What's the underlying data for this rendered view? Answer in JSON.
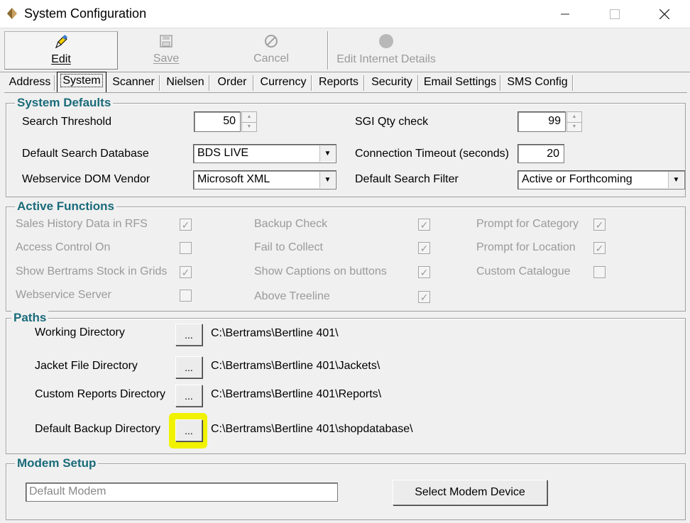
{
  "window": {
    "title": "System Configuration",
    "icon": "app-icon",
    "controls": {
      "minimize": "—",
      "maximize": "☐",
      "close": "✕"
    }
  },
  "toolbar": {
    "edit_label": "Edit",
    "save_label": "Save",
    "cancel_label": "Cancel",
    "edit_internet_label": "Edit Internet Details"
  },
  "tabs": [
    "Address",
    "System",
    "Scanner",
    "Nielsen",
    "Order",
    "Currency",
    "Reports",
    "Security",
    "Email Settings",
    "SMS Config"
  ],
  "active_tab": "System",
  "system_defaults": {
    "title": "System Defaults",
    "search_threshold": {
      "label": "Search Threshold",
      "value": "50"
    },
    "sgi_qty_check": {
      "label": "SGI Qty check",
      "value": "99"
    },
    "default_search_database": {
      "label": "Default Search Database",
      "value": "BDS LIVE"
    },
    "connection_timeout": {
      "label": "Connection Timeout (seconds)",
      "value": "20"
    },
    "webservice_dom_vendor": {
      "label": "Webservice DOM Vendor",
      "value": "Microsoft XML"
    },
    "default_search_filter": {
      "label": "Default Search Filter",
      "value": "Active or Forthcoming"
    }
  },
  "active_functions": {
    "title": "Active Functions",
    "items": [
      {
        "label": "Sales History Data in RFS",
        "checked": true
      },
      {
        "label": "Access Control On",
        "checked": false
      },
      {
        "label": "Show Bertrams Stock in Grids",
        "checked": true
      },
      {
        "label": "Webservice Server",
        "checked": false
      },
      {
        "label": "Backup Check",
        "checked": true
      },
      {
        "label": "Fail to Collect",
        "checked": true
      },
      {
        "label": "Show Captions on buttons",
        "checked": true
      },
      {
        "label": "Above Treeline",
        "checked": true
      },
      {
        "label": "Prompt for Category",
        "checked": true
      },
      {
        "label": "Prompt for Location",
        "checked": true
      },
      {
        "label": "Custom Catalogue",
        "checked": false
      }
    ],
    "check_glyph": "✓"
  },
  "paths": {
    "title": "Paths",
    "browse_label": "...",
    "items": [
      {
        "label": "Working Directory",
        "value": "C:\\Bertrams\\Bertline 401\\"
      },
      {
        "label": "Jacket File Directory",
        "value": "C:\\Bertrams\\Bertline 401\\Jackets\\"
      },
      {
        "label": "Custom Reports Directory",
        "value": "C:\\Bertrams\\Bertline 401\\Reports\\"
      },
      {
        "label": "Default Backup Directory",
        "value": "C:\\Bertrams\\Bertline 401\\shopdatabase\\"
      }
    ]
  },
  "modem_setup": {
    "title": "Modem Setup",
    "device_value": "Default Modem",
    "select_button_label": "Select Modem Device"
  },
  "colors": {
    "group_title": "#1a6b7a",
    "highlight": "#f0f200",
    "disabled_text": "#9a9a9a"
  }
}
